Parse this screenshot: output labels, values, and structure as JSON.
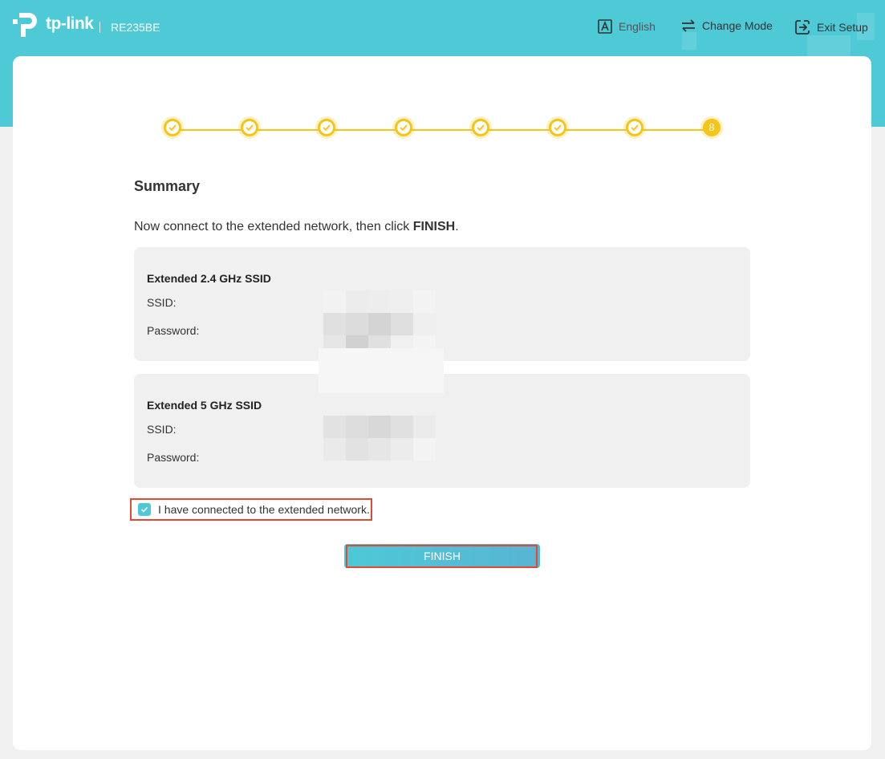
{
  "header": {
    "brand": "tp-link",
    "model": "RE235BE",
    "nav": {
      "language_label": "English",
      "change_mode_label": "Change Mode",
      "exit_setup_label": "Exit Setup"
    }
  },
  "stepper": {
    "total_steps": 8,
    "completed_steps": 7,
    "current_step_label": "8"
  },
  "summary": {
    "title": "Summary",
    "instruction_prefix": "Now connect to the extended network, then click ",
    "instruction_bold": "FINISH",
    "instruction_suffix": ".",
    "band_24": {
      "heading": "Extended 2.4 GHz SSID",
      "ssid_label": "SSID:",
      "password_label": "Password:"
    },
    "band_5": {
      "heading": "Extended 5 GHz SSID",
      "ssid_label": "SSID:",
      "password_label": "Password:"
    }
  },
  "confirm": {
    "checkbox_label": "I have connected to the extended network.",
    "checked": true
  },
  "finish_button_label": "FINISH",
  "colors": {
    "accent": "#4ec9d6",
    "step_yellow": "#f5c518",
    "highlight_red": "#e04a32",
    "panel_gray": "#f0f0f0"
  }
}
